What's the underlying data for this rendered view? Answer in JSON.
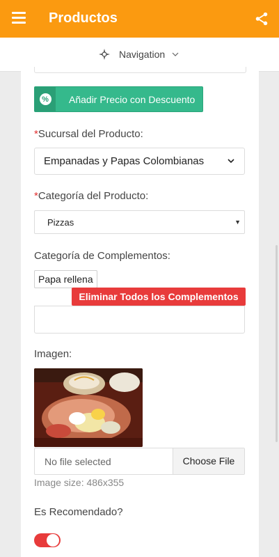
{
  "appbar": {
    "title": "Productos",
    "menu_icon": "hamburger-menu-icon",
    "share_icon": "share-icon",
    "color": "#fb9a10"
  },
  "navbar": {
    "label": "Navigation",
    "icon": "compass-icon"
  },
  "form": {
    "discount_button": "Añadir Precio con Descuento",
    "discount_icon": "percent-icon",
    "branch": {
      "required_mark": "*",
      "label": "Sucursal del Producto:",
      "value": "Empanadas y Papas Colombianas"
    },
    "category": {
      "required_mark": "*",
      "label": "Categoría del Producto:",
      "value": "Pizzas"
    },
    "complements": {
      "label": "Categoría de Complementos:",
      "tags": [
        "Papa rellena"
      ],
      "remove_all_button": "Eliminar Todos los Complementos"
    },
    "image": {
      "label": "Imagen:",
      "file_status": "No file selected",
      "choose_button": "Choose File",
      "size_note": "Image size: 486x355"
    },
    "recommended": {
      "label": "Es Recomendado?",
      "value": true
    }
  },
  "colors": {
    "accent": "#fb9a10",
    "success": "#35b98c",
    "danger": "#e83b3b"
  }
}
